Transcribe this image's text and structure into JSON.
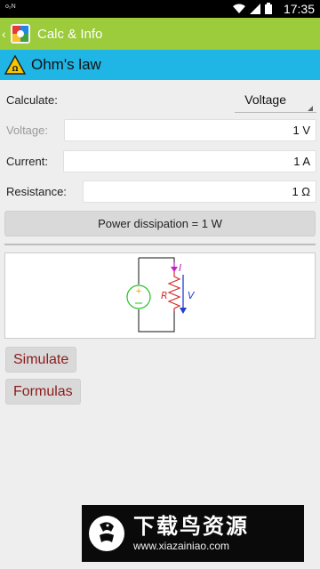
{
  "status": {
    "left_label": "o₂N",
    "time": "17:35"
  },
  "app": {
    "title": "Calc & Info"
  },
  "header": {
    "title": "Ohm's law"
  },
  "calculate": {
    "label": "Calculate:",
    "selected": "Voltage"
  },
  "fields": {
    "voltage": {
      "label": "Voltage:",
      "value": "1 V"
    },
    "current": {
      "label": "Current:",
      "value": "1 A"
    },
    "resistance": {
      "label": "Resistance:",
      "value": "1 Ω"
    }
  },
  "power_button": "Power dissipation = 1  W",
  "circuit": {
    "current_symbol": "I",
    "resistor_symbol": "R",
    "voltage_symbol": "V"
  },
  "buttons": {
    "simulate": "Simulate",
    "formulas": "Formulas"
  },
  "watermark": {
    "brand": "下载鸟资源",
    "url": "www.xiazainiao.com"
  },
  "colors": {
    "appbar": "#9ccb3b",
    "header": "#1fb6e6",
    "button_text": "#8b1a1a"
  }
}
